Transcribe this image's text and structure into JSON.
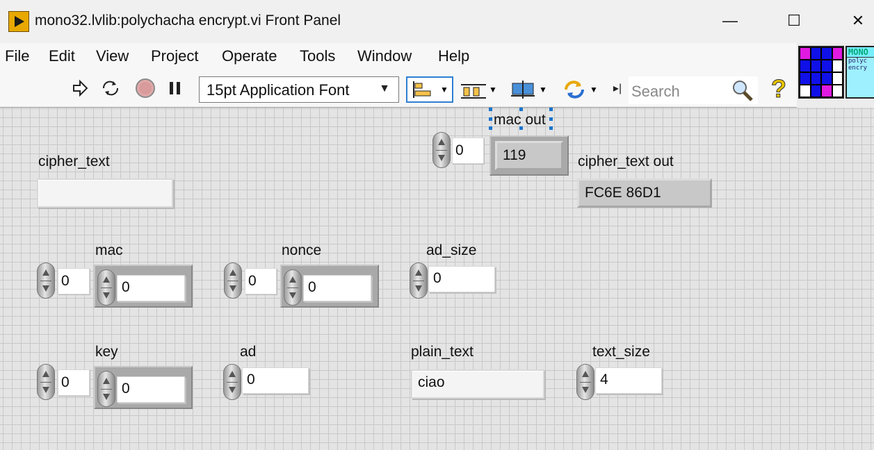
{
  "window": {
    "title": "mono32.lvlib:polychacha encrypt.vi Front Panel",
    "minimize": "—",
    "maximize": "☐",
    "close": "✕"
  },
  "menu": [
    "File",
    "Edit",
    "View",
    "Project",
    "Operate",
    "Tools",
    "Window",
    "Help"
  ],
  "toolbar": {
    "font": "15pt Application Font",
    "search_placeholder": "Search",
    "help": "?"
  },
  "vi_icon": {
    "header": "MONO",
    "lines": [
      "polyc",
      "encry"
    ]
  },
  "panel": {
    "mac_out": {
      "label": "mac out",
      "index": "0",
      "value": "119"
    },
    "cipher_text": {
      "label": "cipher_text",
      "value": ""
    },
    "cipher_text_out": {
      "label": "cipher_text out",
      "value": "FC6E 86D1"
    },
    "mac": {
      "label": "mac",
      "index": "0",
      "value": "0"
    },
    "nonce": {
      "label": "nonce",
      "index": "0",
      "value": "0"
    },
    "ad_size": {
      "label": "ad_size",
      "value": "0"
    },
    "key": {
      "label": "key",
      "index": "0",
      "value": "0"
    },
    "ad": {
      "label": "ad",
      "value": "0"
    },
    "plain_text": {
      "label": "plain_text",
      "value": "ciao"
    },
    "text_size": {
      "label": "text_size",
      "value": "4"
    }
  }
}
